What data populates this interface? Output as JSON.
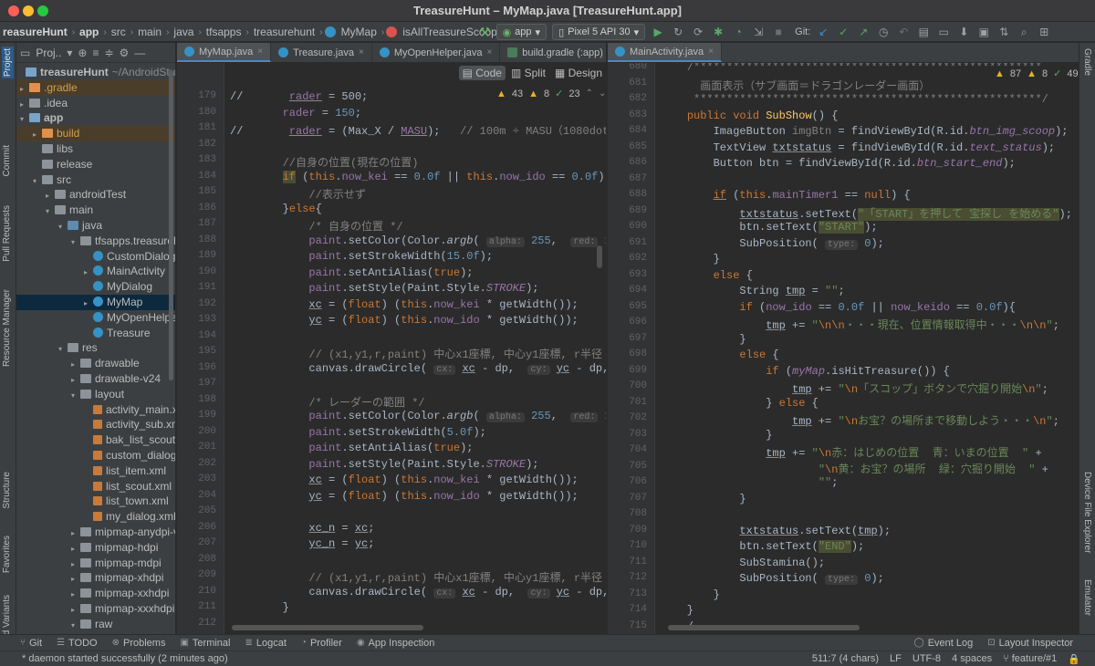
{
  "window": {
    "title": "TreasureHunt – MyMap.java [TreasureHunt.app]"
  },
  "breadcrumbs": [
    "reasureHunt",
    "app",
    "src",
    "main",
    "java",
    "tfsapps",
    "treasurehunt",
    "MyMap",
    "isAllTreasureScoopDone"
  ],
  "toolbar": {
    "run_config": "app",
    "device": "Pixel 5 API 30",
    "git_label": "Git:"
  },
  "left_strip": {
    "tabs": [
      "Project",
      "Commit",
      "Pull Requests",
      "Resource Manager",
      "Structure",
      "Favorites",
      "Build Variants"
    ]
  },
  "project_panel": {
    "view_label": "Proj..",
    "tree": [
      {
        "label": "treasureHunt",
        "extra": "~/AndroidStudioP",
        "indent": 0,
        "arrow": "",
        "icon": "mod",
        "bold": true
      },
      {
        "label": ".gradle",
        "extra": "",
        "indent": 1,
        "arrow": "▸",
        "icon": "folder-o",
        "hl": true,
        "orange": true
      },
      {
        "label": ".idea",
        "extra": "",
        "indent": 1,
        "arrow": "▸",
        "icon": "folder"
      },
      {
        "label": "app",
        "extra": "",
        "indent": 1,
        "arrow": "▾",
        "icon": "mod",
        "bold": true
      },
      {
        "label": "build",
        "extra": "",
        "indent": 2,
        "arrow": "▸",
        "icon": "folder-o",
        "hl": true,
        "orange": true
      },
      {
        "label": "libs",
        "extra": "",
        "indent": 2,
        "arrow": "",
        "icon": "folder"
      },
      {
        "label": "release",
        "extra": "",
        "indent": 2,
        "arrow": "",
        "icon": "folder"
      },
      {
        "label": "src",
        "extra": "",
        "indent": 2,
        "arrow": "▾",
        "icon": "folder"
      },
      {
        "label": "androidTest",
        "extra": "",
        "indent": 3,
        "arrow": "▸",
        "icon": "folder"
      },
      {
        "label": "main",
        "extra": "",
        "indent": 3,
        "arrow": "▾",
        "icon": "folder"
      },
      {
        "label": "java",
        "extra": "",
        "indent": 4,
        "arrow": "▾",
        "icon": "folder-b"
      },
      {
        "label": "tfsapps.treasurehu",
        "extra": "",
        "indent": 5,
        "arrow": "▾",
        "icon": "folder"
      },
      {
        "label": "CustomDialog",
        "extra": "",
        "indent": 6,
        "arrow": "",
        "icon": "cls"
      },
      {
        "label": "MainActivity",
        "extra": "",
        "indent": 6,
        "arrow": "▸",
        "icon": "cls"
      },
      {
        "label": "MyDialog",
        "extra": "",
        "indent": 6,
        "arrow": "",
        "icon": "cls"
      },
      {
        "label": "MyMap",
        "extra": "",
        "indent": 6,
        "arrow": "▸",
        "icon": "cls",
        "sel": true
      },
      {
        "label": "MyOpenHelper",
        "extra": "",
        "indent": 6,
        "arrow": "",
        "icon": "cls"
      },
      {
        "label": "Treasure",
        "extra": "",
        "indent": 6,
        "arrow": "",
        "icon": "cls"
      },
      {
        "label": "res",
        "extra": "",
        "indent": 4,
        "arrow": "▾",
        "icon": "folder"
      },
      {
        "label": "drawable",
        "extra": "",
        "indent": 5,
        "arrow": "▸",
        "icon": "folder"
      },
      {
        "label": "drawable-v24",
        "extra": "",
        "indent": 5,
        "arrow": "▸",
        "icon": "folder"
      },
      {
        "label": "layout",
        "extra": "",
        "indent": 5,
        "arrow": "▾",
        "icon": "folder"
      },
      {
        "label": "activity_main.xı",
        "extra": "",
        "indent": 6,
        "arrow": "",
        "icon": "xml"
      },
      {
        "label": "activity_sub.xm",
        "extra": "",
        "indent": 6,
        "arrow": "",
        "icon": "xml"
      },
      {
        "label": "bak_list_scout.",
        "extra": "",
        "indent": 6,
        "arrow": "",
        "icon": "xml"
      },
      {
        "label": "custom_dialog.",
        "extra": "",
        "indent": 6,
        "arrow": "",
        "icon": "xml"
      },
      {
        "label": "list_item.xml",
        "extra": "",
        "indent": 6,
        "arrow": "",
        "icon": "xml"
      },
      {
        "label": "list_scout.xml",
        "extra": "",
        "indent": 6,
        "arrow": "",
        "icon": "xml"
      },
      {
        "label": "list_town.xml",
        "extra": "",
        "indent": 6,
        "arrow": "",
        "icon": "xml"
      },
      {
        "label": "my_dialog.xml",
        "extra": "",
        "indent": 6,
        "arrow": "",
        "icon": "xml"
      },
      {
        "label": "mipmap-anydpi-v",
        "extra": "",
        "indent": 5,
        "arrow": "▸",
        "icon": "folder"
      },
      {
        "label": "mipmap-hdpi",
        "extra": "",
        "indent": 5,
        "arrow": "▸",
        "icon": "folder"
      },
      {
        "label": "mipmap-mdpi",
        "extra": "",
        "indent": 5,
        "arrow": "▸",
        "icon": "folder"
      },
      {
        "label": "mipmap-xhdpi",
        "extra": "",
        "indent": 5,
        "arrow": "▸",
        "icon": "folder"
      },
      {
        "label": "mipmap-xxhdpi",
        "extra": "",
        "indent": 5,
        "arrow": "▸",
        "icon": "folder"
      },
      {
        "label": "mipmap-xxxhdpi",
        "extra": "",
        "indent": 5,
        "arrow": "▸",
        "icon": "folder"
      },
      {
        "label": "raw",
        "extra": "",
        "indent": 5,
        "arrow": "▾",
        "icon": "folder"
      }
    ]
  },
  "left_tabs": [
    {
      "label": "MyMap.java",
      "active": true,
      "icon": "c"
    },
    {
      "label": "Treasure.java",
      "active": false,
      "icon": "c"
    },
    {
      "label": "MyOpenHelper.java",
      "active": false,
      "icon": "c"
    },
    {
      "label": "build.gradle (:app)",
      "active": false,
      "icon": "g"
    }
  ],
  "right_tabs": [
    {
      "label": "MainActivity.java",
      "active": true,
      "icon": "c"
    }
  ],
  "view_modes": [
    "Code",
    "Split",
    "Design"
  ],
  "left_inspections": {
    "warnings": "43",
    "weak": "8",
    "ok": "23"
  },
  "right_inspections": {
    "warnings": "87",
    "weak": "8",
    "ok": "49"
  },
  "left_editor": {
    "line_numbers": [
      "179",
      "180",
      "181",
      "182",
      "183",
      "184",
      "185",
      "186",
      "187",
      "188",
      "189",
      "190",
      "191",
      "192",
      "193",
      "194",
      "195",
      "196",
      "197",
      "198",
      "199",
      "200",
      "201",
      "202",
      "203",
      "204",
      "205",
      "206",
      "207",
      "208",
      "209",
      "210",
      "211",
      "212"
    ]
  },
  "right_editor": {
    "line_numbers": [
      "680",
      "681",
      "682",
      "683",
      "684",
      "685",
      "686",
      "687",
      "688",
      "689",
      "690",
      "691",
      "692",
      "693",
      "694",
      "695",
      "696",
      "697",
      "698",
      "699",
      "700",
      "701",
      "702",
      "703",
      "704",
      "705",
      "706",
      "707",
      "708",
      "709",
      "710",
      "711",
      "712",
      "713",
      "714",
      "715"
    ]
  },
  "right_strip": {
    "tabs": [
      "Gradle",
      "Device File Explorer",
      "Emulator"
    ]
  },
  "bottom_tools": [
    "Git",
    "TODO",
    "Problems",
    "Terminal",
    "Logcat",
    "Profiler",
    "App Inspection",
    "Event Log",
    "Layout Inspector"
  ],
  "status": {
    "message": "* daemon started successfully (2 minutes ago)",
    "position": "511:7 (4 chars)",
    "line_sep": "LF",
    "encoding": "UTF-8",
    "indent": "4 spaces",
    "branch": "feature/#1"
  }
}
